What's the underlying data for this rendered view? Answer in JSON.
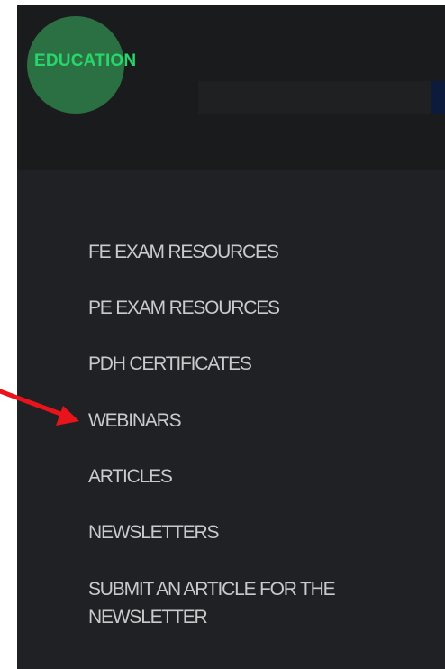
{
  "brand": {
    "name": "EDUCATION"
  },
  "menu": {
    "items": [
      {
        "label": "FE EXAM RESOURCES"
      },
      {
        "label": "PE EXAM RESOURCES"
      },
      {
        "label": "PDH CERTIFICATES"
      },
      {
        "label": "WEBINARS"
      },
      {
        "label": "ARTICLES"
      },
      {
        "label": "NEWSLETTERS"
      },
      {
        "label": "SUBMIT AN ARTICLE FOR THE NEWSLETTER"
      }
    ]
  },
  "annotation": {
    "arrow_color": "#e8131b",
    "points_to": "WEBINARS"
  },
  "colors": {
    "panel_background": "#202124",
    "header_background": "#1a1b1d",
    "brand_circle": "#2e7a47",
    "brand_text": "#29d66b",
    "menu_text": "#c9cacb"
  }
}
